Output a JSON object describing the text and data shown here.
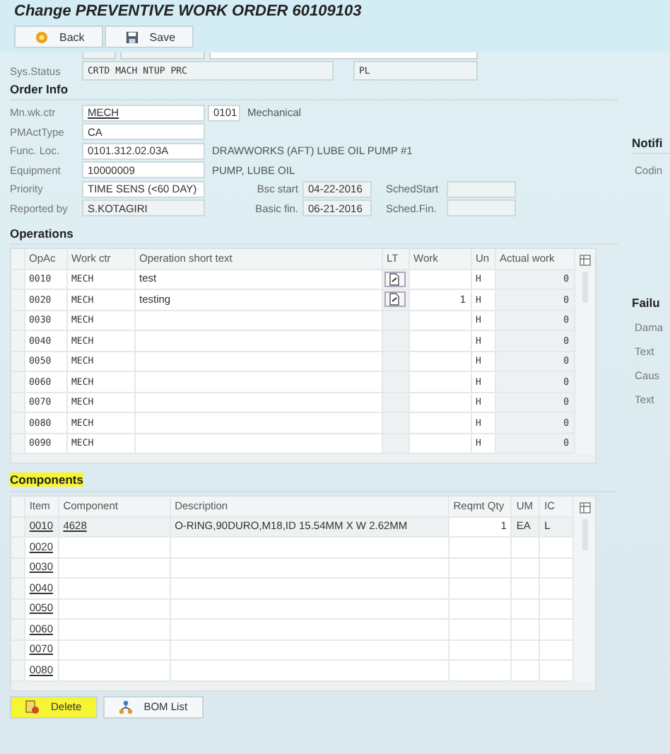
{
  "window": {
    "title": "Change PREVENTIVE WORK ORDER 60109103"
  },
  "toolbar": [
    {
      "label": "Back"
    },
    {
      "label": "Save"
    }
  ],
  "sys_status": {
    "label": "Sys.Status",
    "values": [
      "CRTD MACH NTUP PRC",
      "PL"
    ]
  },
  "order_info": {
    "title": "Order Info",
    "rows": [
      {
        "label": "Mn.wk.ctr",
        "field": {
          "kind": "input",
          "value": "MECH",
          "link": true
        },
        "code": "0101",
        "note": "Mechanical"
      },
      {
        "label": "PMActType",
        "field": {
          "kind": "input",
          "value": "CA",
          "link": false
        }
      },
      {
        "label": "Func. Loc.",
        "field": {
          "kind": "input",
          "value": "0101.312.02.03A",
          "link": false
        },
        "note": "DRAWWORKS (AFT) LUBE OIL PUMP #1"
      },
      {
        "label": "Equipment",
        "field": {
          "kind": "input",
          "value": "10000009",
          "link": false
        },
        "note": "PUMP, LUBE OIL"
      },
      {
        "label": "Priority",
        "field": {
          "kind": "dropdown",
          "value": "TIME SENS (<60 DAY)",
          "link": false
        },
        "dates": [
          {
            "label": "Bsc start",
            "value": "04-22-2016"
          },
          {
            "label": "SchedStart"
          }
        ]
      },
      {
        "label": "Reported by",
        "field": {
          "kind": "display",
          "value": "S.KOTAGIRI",
          "link": false
        },
        "dates": [
          {
            "label": "Basic fin.",
            "value": "06-21-2016"
          },
          {
            "label": "Sched.Fin."
          }
        ]
      }
    ]
  },
  "notification": {
    "title": "Notifi",
    "labels": [
      "Codin"
    ]
  },
  "failure": {
    "title": "Failu",
    "labels": [
      "Dama",
      "Text",
      "Caus",
      "Text"
    ]
  },
  "operations": {
    "title": "Operations",
    "highlighted": false,
    "columns": [
      "OpAc",
      "Work ctr",
      "Operation short text",
      "LT",
      "Work",
      "Un",
      "Actual work"
    ],
    "rows": [
      {
        "opac": "0010",
        "work_ctr": "MECH",
        "text": "test",
        "long_text": true,
        "work": "",
        "un": "H",
        "actual": "0"
      },
      {
        "opac": "0020",
        "work_ctr": "MECH",
        "text": "testing",
        "long_text": true,
        "work": "1",
        "un": "H",
        "actual": "0"
      },
      {
        "opac": "0030",
        "work_ctr": "MECH",
        "text": "",
        "long_text": false,
        "work": "",
        "un": "H",
        "actual": "0"
      },
      {
        "opac": "0040",
        "work_ctr": "MECH",
        "text": "",
        "long_text": false,
        "work": "",
        "un": "H",
        "actual": "0"
      },
      {
        "opac": "0050",
        "work_ctr": "MECH",
        "text": "",
        "long_text": false,
        "work": "",
        "un": "H",
        "actual": "0"
      },
      {
        "opac": "0060",
        "work_ctr": "MECH",
        "text": "",
        "long_text": false,
        "work": "",
        "un": "H",
        "actual": "0"
      },
      {
        "opac": "0070",
        "work_ctr": "MECH",
        "text": "",
        "long_text": false,
        "work": "",
        "un": "H",
        "actual": "0"
      },
      {
        "opac": "0080",
        "work_ctr": "MECH",
        "text": "",
        "long_text": false,
        "work": "",
        "un": "H",
        "actual": "0"
      },
      {
        "opac": "0090",
        "work_ctr": "MECH",
        "text": "",
        "long_text": false,
        "work": "",
        "un": "H",
        "actual": "0"
      }
    ]
  },
  "components": {
    "title": "Components",
    "highlighted": true,
    "columns": [
      "Item",
      "Component",
      "Description",
      "Reqmt Qty",
      "UM",
      "IC"
    ],
    "rows": [
      {
        "item": "0010",
        "component": "4628",
        "description": "O-RING,90DURO,M18,ID 15.54MM X W 2.62MM",
        "qty": "1",
        "um": "EA",
        "ic": "L"
      },
      {
        "item": "0020",
        "component": "",
        "description": "",
        "qty": "",
        "um": "",
        "ic": ""
      },
      {
        "item": "0030",
        "component": "",
        "description": "",
        "qty": "",
        "um": "",
        "ic": ""
      },
      {
        "item": "0040",
        "component": "",
        "description": "",
        "qty": "",
        "um": "",
        "ic": ""
      },
      {
        "item": "0050",
        "component": "",
        "description": "",
        "qty": "",
        "um": "",
        "ic": ""
      },
      {
        "item": "0060",
        "component": "",
        "description": "",
        "qty": "",
        "um": "",
        "ic": ""
      },
      {
        "item": "0070",
        "component": "",
        "description": "",
        "qty": "",
        "um": "",
        "ic": ""
      },
      {
        "item": "0080",
        "component": "",
        "description": "",
        "qty": "",
        "um": "",
        "ic": ""
      }
    ]
  },
  "actions": [
    {
      "label": "Delete",
      "highlighted": true
    },
    {
      "label": "BOM List",
      "highlighted": false
    }
  ]
}
